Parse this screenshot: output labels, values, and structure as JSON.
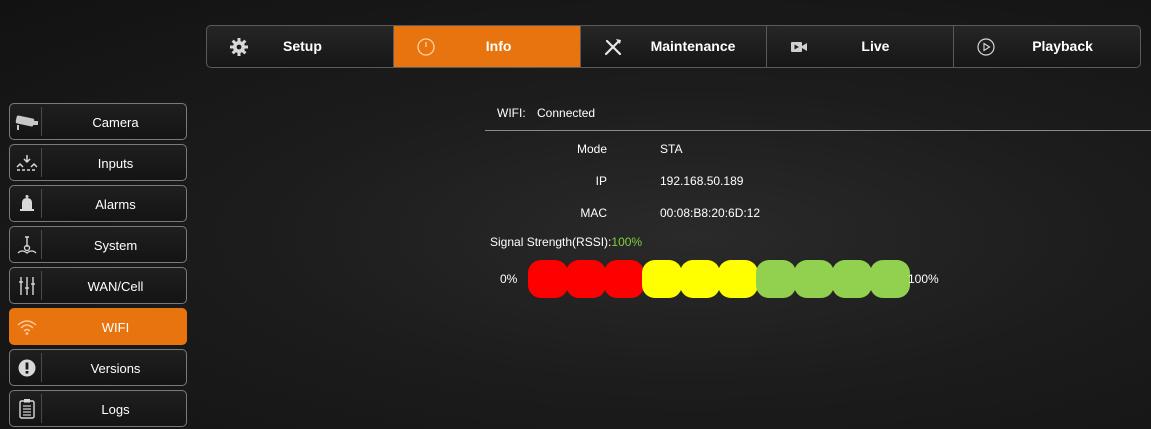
{
  "topnav": {
    "tabs": [
      {
        "label": "Setup",
        "icon": "gear-icon"
      },
      {
        "label": "Info",
        "icon": "info-clock-icon"
      },
      {
        "label": "Maintenance",
        "icon": "tools-icon"
      },
      {
        "label": "Live",
        "icon": "video-camera-icon"
      },
      {
        "label": "Playback",
        "icon": "play-circle-icon"
      }
    ],
    "active_tab": "Info"
  },
  "sidebar": {
    "items": [
      {
        "label": "Camera",
        "icon": "cctv-camera-icon"
      },
      {
        "label": "Inputs",
        "icon": "inputs-icon"
      },
      {
        "label": "Alarms",
        "icon": "bell-icon"
      },
      {
        "label": "System",
        "icon": "system-icon"
      },
      {
        "label": "WAN/Cell",
        "icon": "sliders-icon"
      },
      {
        "label": "WIFI",
        "icon": "wifi-icon"
      },
      {
        "label": "Versions",
        "icon": "alert-circle-icon"
      },
      {
        "label": "Logs",
        "icon": "clipboard-icon"
      }
    ],
    "active_item": "WIFI"
  },
  "wifi": {
    "title": "WIFI:",
    "status": "Connected",
    "mode_label": "Mode",
    "mode_value": "STA",
    "ip_label": "IP",
    "ip_value": "192.168.50.189",
    "mac_label": "MAC",
    "mac_value": "00:08:B8:20:6D:12",
    "signal_label": "Signal Strength(RSSI):",
    "signal_value": "100%",
    "signal_fraction": 1.0,
    "meter_min_label": "0%",
    "meter_max_label": "100%"
  },
  "colors": {
    "accent": "#e8740f",
    "meter_red": "#ff0000",
    "meter_yellow": "#ffff00",
    "meter_green": "#92d050",
    "signal_value": "#7ed23d"
  }
}
